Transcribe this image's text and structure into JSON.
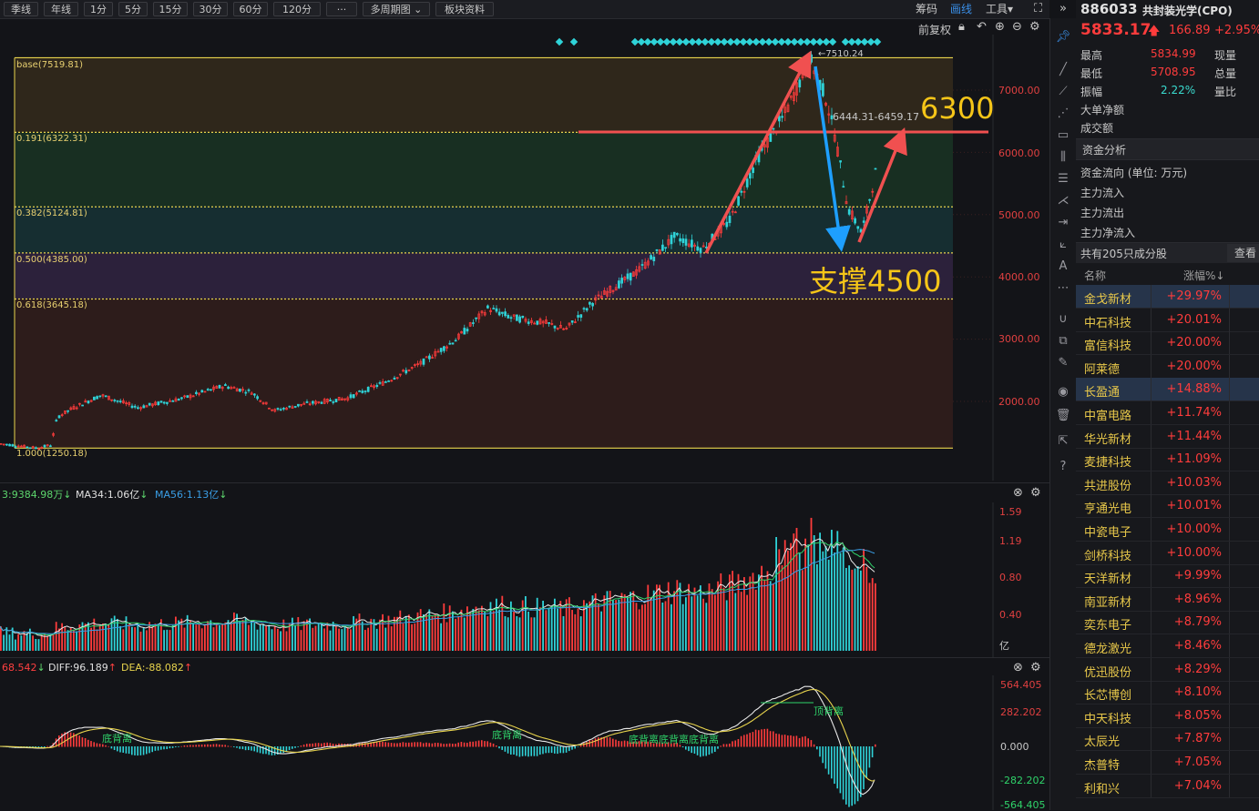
{
  "toolbar": {
    "periods": [
      "季线",
      "年线",
      "1分",
      "5分",
      "15分",
      "30分",
      "60分",
      "120分",
      "···",
      "多周期图",
      "板块资料"
    ],
    "right_links": [
      "筹码",
      "画线",
      "工具"
    ],
    "fuquan": "前复权"
  },
  "main_chart": {
    "y_axis": [
      "7000.00",
      "6000.00",
      "5000.00",
      "4000.00",
      "3000.00",
      "2000.00"
    ],
    "fib_levels": [
      {
        "label": "base(7519.81)",
        "value": 7519.81
      },
      {
        "label": "0.191(6322.31)",
        "value": 6322.31
      },
      {
        "label": "0.382(5124.81)",
        "value": 5124.81
      },
      {
        "label": "0.500(4385.00)",
        "value": 4385.0
      },
      {
        "label": "0.618(3645.18)",
        "value": 3645.18
      },
      {
        "label": "1.000(1250.18)",
        "value": 1250.18
      }
    ],
    "peak_label": "←7510.24",
    "range_label": "6444.31-6459.17",
    "annotation_6300": "6300",
    "annotation_support": "支撑4500",
    "colors": {
      "up": "#ff3c3c",
      "down": "#2fd3d8",
      "fib_line": "#e8d44d",
      "arrow_red": "#f05050",
      "arrow_blue": "#1e9fff",
      "annotation": "#f5c518"
    }
  },
  "volume_pane": {
    "label_a": "3:9384.98万",
    "label_b": "MA34:1.06亿",
    "label_c": "MA56:1.13亿",
    "y_axis": [
      "1.59",
      "1.19",
      "0.80",
      "0.40"
    ],
    "unit": "亿"
  },
  "macd_pane": {
    "label_a": "68.542",
    "label_b": "DIFF:96.189",
    "label_c": "DEA:-88.082",
    "y_axis": [
      "564.405",
      "282.202",
      "0.000",
      "-282.202",
      "-564.405"
    ],
    "divergence_labels": [
      "底背离",
      "底背离",
      "底背离底背离底背离",
      "顶背离"
    ]
  },
  "quote": {
    "code": "886033",
    "name": "共封装光学(CPO)",
    "price": "5833.17",
    "change": "166.89",
    "change_pct": "+2.95%",
    "rows": [
      {
        "label": "最高",
        "value": "5834.99",
        "label2": "现量"
      },
      {
        "label": "最低",
        "value": "5708.95",
        "label2": "总量"
      },
      {
        "label": "振幅",
        "value": "2.22%",
        "label2": "量比"
      },
      {
        "label": "大单净额",
        "value": "",
        "label2": ""
      },
      {
        "label": "成交额",
        "value": "",
        "label2": ""
      }
    ],
    "fund_header": "资金分析",
    "fund_rows": [
      "资金流向 (单位: 万元)",
      "主力流入",
      "主力流出",
      "主力净流入"
    ],
    "constituents_text": "共有205只成分股",
    "view_button": "查看",
    "col_name": "名称",
    "col_pct": "涨幅%↓"
  },
  "stocks": [
    {
      "name": "金戈新材",
      "pct": "+29.97%"
    },
    {
      "name": "中石科技",
      "pct": "+20.01%"
    },
    {
      "name": "富信科技",
      "pct": "+20.00%"
    },
    {
      "name": "阿莱德",
      "pct": "+20.00%"
    },
    {
      "name": "长盈通",
      "pct": "+14.88%"
    },
    {
      "name": "中富电路",
      "pct": "+11.74%"
    },
    {
      "name": "华光新材",
      "pct": "+11.44%"
    },
    {
      "name": "麦捷科技",
      "pct": "+11.09%"
    },
    {
      "name": "共进股份",
      "pct": "+10.03%"
    },
    {
      "name": "亨通光电",
      "pct": "+10.01%"
    },
    {
      "name": "中瓷电子",
      "pct": "+10.00%"
    },
    {
      "name": "剑桥科技",
      "pct": "+10.00%"
    },
    {
      "name": "天洋新材",
      "pct": "+9.99%"
    },
    {
      "name": "南亚新材",
      "pct": "+8.96%"
    },
    {
      "name": "奕东电子",
      "pct": "+8.79%"
    },
    {
      "name": "德龙激光",
      "pct": "+8.46%"
    },
    {
      "name": "优迅股份",
      "pct": "+8.29%"
    },
    {
      "name": "长芯博创",
      "pct": "+8.10%"
    },
    {
      "name": "中天科技",
      "pct": "+8.05%"
    },
    {
      "name": "太辰光",
      "pct": "+7.87%"
    },
    {
      "name": "杰普特",
      "pct": "+7.05%"
    },
    {
      "name": "利和兴",
      "pct": "+7.04%"
    }
  ],
  "icons": {
    "sidebar": [
      "pin-icon",
      "line-icon",
      "ray-icon",
      "segment-icon",
      "rect-icon",
      "parallel-icon",
      "channel-icon",
      "fan-icon",
      "measure-icon",
      "text-icon",
      "more-icon",
      "magnet-icon",
      "copy-icon",
      "pen-icon",
      "eye-icon",
      "trash-icon",
      "export-icon",
      "help-icon"
    ]
  }
}
